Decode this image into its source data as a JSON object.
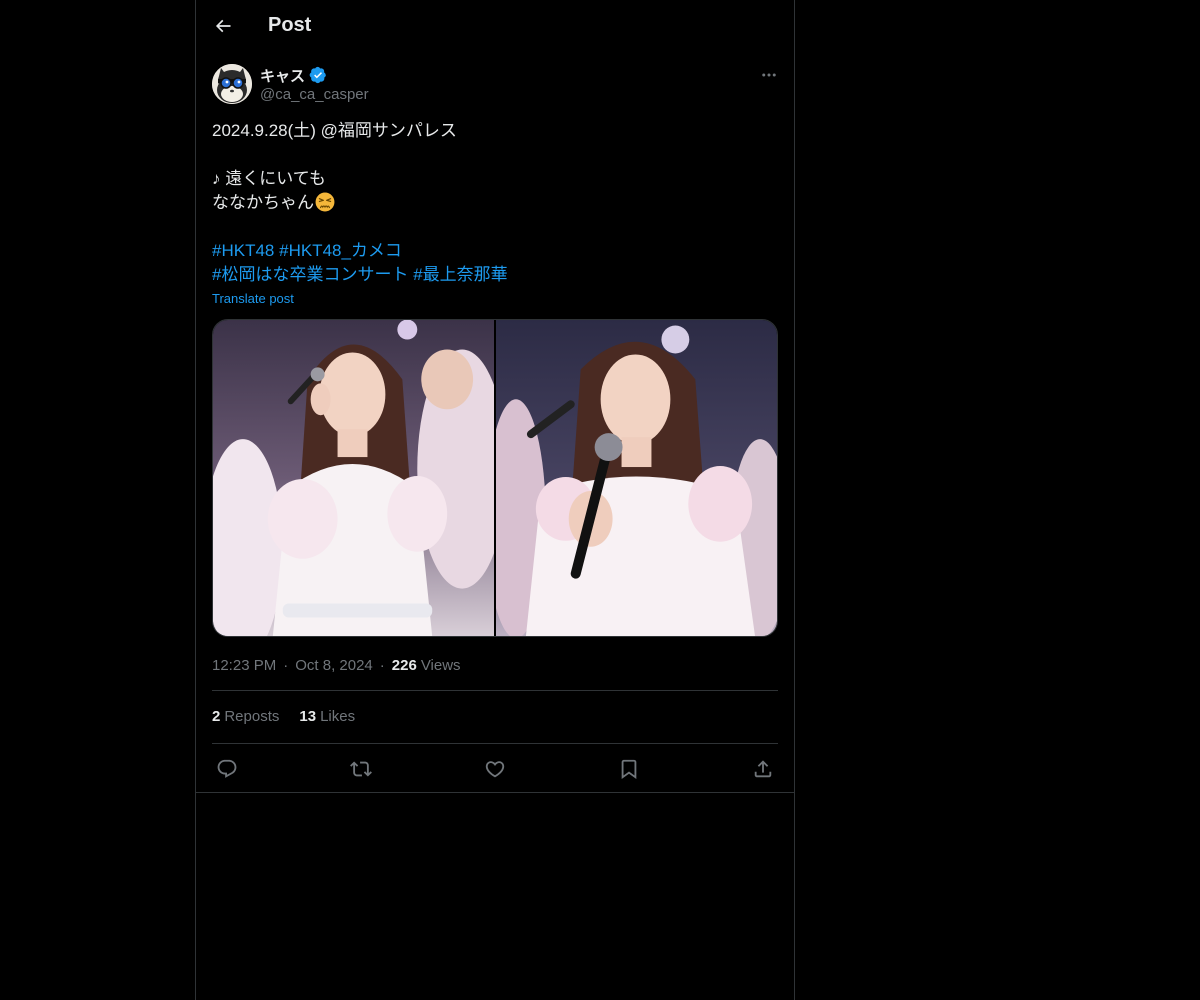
{
  "header": {
    "title": "Post"
  },
  "author": {
    "display_name": "キャス",
    "handle": "@ca_ca_casper",
    "verified": true
  },
  "tweet": {
    "line1": "2024.9.28(土) @福岡サンパレス",
    "line2": "♪ 遠くにいても",
    "line3": "ななかちゃん",
    "line3_emoji": "persevering-face-emoji",
    "hashtags_row1": [
      "#HKT48",
      "#HKT48_カメコ"
    ],
    "hashtags_row2": [
      "#松岡はな卒業コンサート",
      "#最上奈那華"
    ]
  },
  "translate_label": "Translate post",
  "meta": {
    "time": "12:23 PM",
    "date": "Oct 8, 2024",
    "views_count": "226",
    "views_label": "Views"
  },
  "engagement": {
    "reposts_count": "2",
    "reposts_label": "Reposts",
    "likes_count": "13",
    "likes_label": "Likes"
  },
  "colors": {
    "background": "#000000",
    "text": "#e7e9ea",
    "muted": "#71767b",
    "accent": "#1d9bf0",
    "border": "#2f3336"
  },
  "icons": [
    "back-arrow-icon",
    "verified-badge-icon",
    "more-icon",
    "reply-icon",
    "repost-icon",
    "like-icon",
    "bookmark-icon",
    "share-icon"
  ]
}
